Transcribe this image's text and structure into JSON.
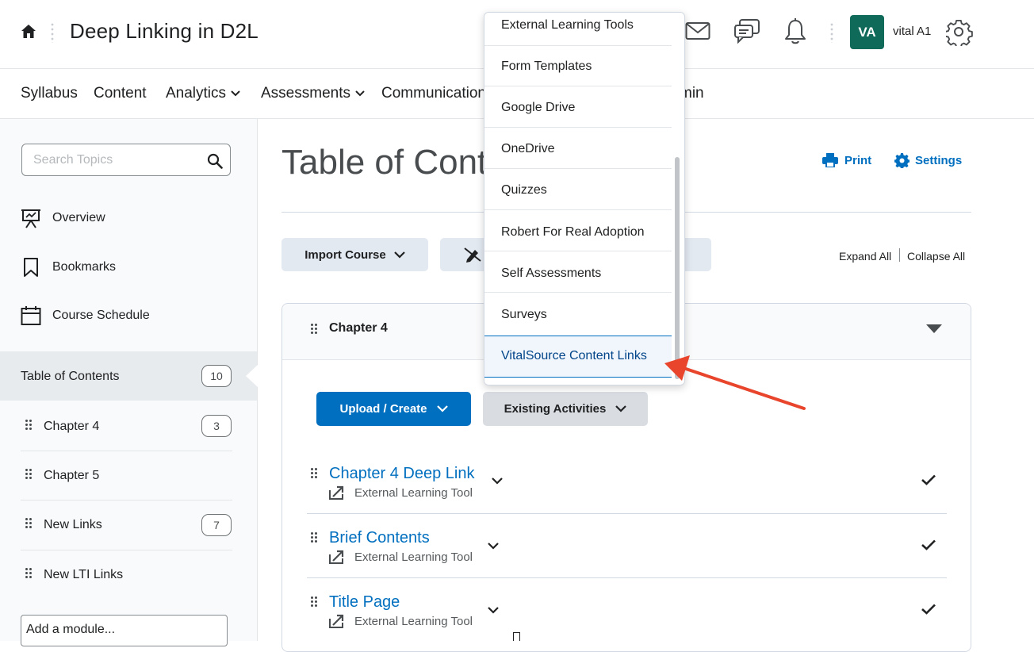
{
  "header": {
    "course_title": "Deep Linking in D2L",
    "avatar_initials": "VA",
    "user_name": "vital A1",
    "avatar_color": "#0f6a5a"
  },
  "nav": {
    "items": [
      "Syllabus",
      "Content",
      "Analytics",
      "Assessments",
      "Communication"
    ],
    "partial_item": "min"
  },
  "sidebar": {
    "search_placeholder": "Search Topics",
    "links": [
      "Overview",
      "Bookmarks",
      "Course Schedule"
    ],
    "toc": {
      "label": "Table of Contents",
      "count": "10"
    },
    "modules": [
      {
        "label": "Chapter 4",
        "count": "3"
      },
      {
        "label": "Chapter 5",
        "count": ""
      },
      {
        "label": "New Links",
        "count": "7"
      },
      {
        "label": "New LTI Links",
        "count": ""
      }
    ],
    "add_module": "Add a module..."
  },
  "main": {
    "title": "Table of Conte",
    "print_label": "Print",
    "settings_label": "Settings",
    "import_label": "Import Course",
    "expand_all": "Expand All",
    "collapse_all": "Collapse All",
    "module_title": "Chapter 4",
    "upload_label": "Upload / Create",
    "existing_label": "Existing Activities",
    "topics": [
      {
        "title": "Chapter 4 Deep Link",
        "type": "External Learning Tool"
      },
      {
        "title": "Brief Contents",
        "type": "External Learning Tool"
      },
      {
        "title": "Title Page",
        "type": "External Learning Tool"
      }
    ],
    "accent_color": "#006fbf"
  },
  "dropdown": {
    "items": [
      "External Learning Tools",
      "Form Templates",
      "Google Drive",
      "OneDrive",
      "Quizzes",
      "Robert For Real Adoption",
      "Self Assessments",
      "Surveys",
      "VitalSource Content Links"
    ],
    "highlighted": "VitalSource Content Links"
  },
  "annotation": {
    "arrow_color": "#e8452c"
  }
}
